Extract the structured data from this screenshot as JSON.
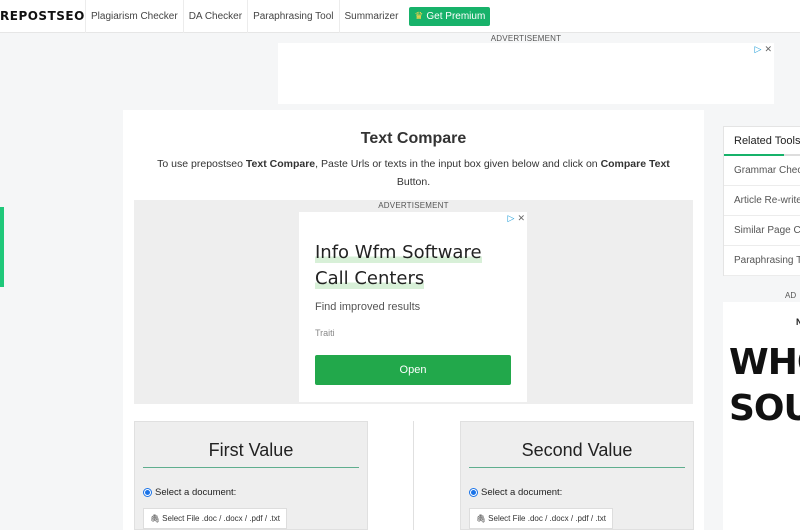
{
  "nav": {
    "logo": "REPOSTSEO",
    "items": [
      "Plagiarism Checker",
      "DA Checker",
      "Paraphrasing Tool",
      "Summarizer"
    ],
    "premium": "Get Premium"
  },
  "top_ad": {
    "label": "ADVERTISEMENT"
  },
  "main": {
    "title": "Text Compare",
    "desc_prefix": "To use prepostseo ",
    "desc_bold1": "Text Compare",
    "desc_mid": ", Paste Urls or texts in the input box given below and click on ",
    "desc_bold2": "Compare Text",
    "desc_suffix": " Button.",
    "inner_ad": {
      "label": "ADVERTISEMENT",
      "headline_line1": "Info Wfm Software",
      "headline_line2": "Call Centers",
      "sub": "Find improved results",
      "brand": "Traiti",
      "button": "Open"
    },
    "first": {
      "title": "First Value",
      "radio_label": "Select a document:",
      "file_button": "Select File .doc / .docx / .pdf / .txt"
    },
    "second": {
      "title": "Second Value",
      "radio_label": "Select a document:",
      "file_button": "Select File .doc / .docx / .pdf / .txt"
    }
  },
  "sidebar": {
    "related_title": "Related Tools",
    "items": [
      "Grammar Checker",
      "Article Re-writer",
      "Similar Page Checker",
      "Paraphrasing Tool"
    ],
    "ad_label": "AD",
    "ad_small": "N",
    "ad_line1": "WHO",
    "ad_line2": "SOUL"
  },
  "colors": {
    "brand_green": "#17b26a",
    "ad_button": "#22a84b",
    "adchoice_blue": "#1a9bd7"
  }
}
